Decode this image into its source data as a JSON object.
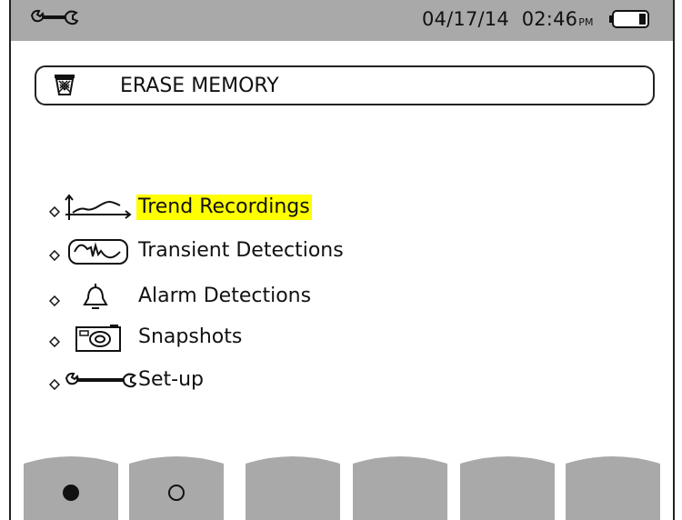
{
  "status_bar": {
    "setup_icon": "wrench-icon",
    "date": "04/17/14",
    "time": "02:46",
    "ampm": "PM",
    "battery_icon": "battery-icon"
  },
  "header": {
    "icon": "trash-bin-icon",
    "title": "ERASE MEMORY"
  },
  "menu": {
    "items": [
      {
        "label": "Trend Recordings",
        "icon": "trend-chart-icon",
        "selected": true
      },
      {
        "label": "Transient Detections",
        "icon": "transient-waveform-icon",
        "selected": false
      },
      {
        "label": "Alarm Detections",
        "icon": "bell-icon",
        "selected": false
      },
      {
        "label": "Snapshots",
        "icon": "camera-icon",
        "selected": false
      },
      {
        "label": "Set-up",
        "icon": "wrench-icon",
        "selected": false
      }
    ]
  },
  "softkeys": [
    {
      "icon": "filled-circle-icon"
    },
    {
      "icon": "empty-circle-icon"
    },
    {
      "icon": ""
    },
    {
      "icon": ""
    },
    {
      "icon": ""
    },
    {
      "icon": ""
    }
  ],
  "colors": {
    "status_bar_bg": "#a9a9a9",
    "softkey_bg": "#a9a9a9",
    "selection_highlight": "#ffff00"
  }
}
